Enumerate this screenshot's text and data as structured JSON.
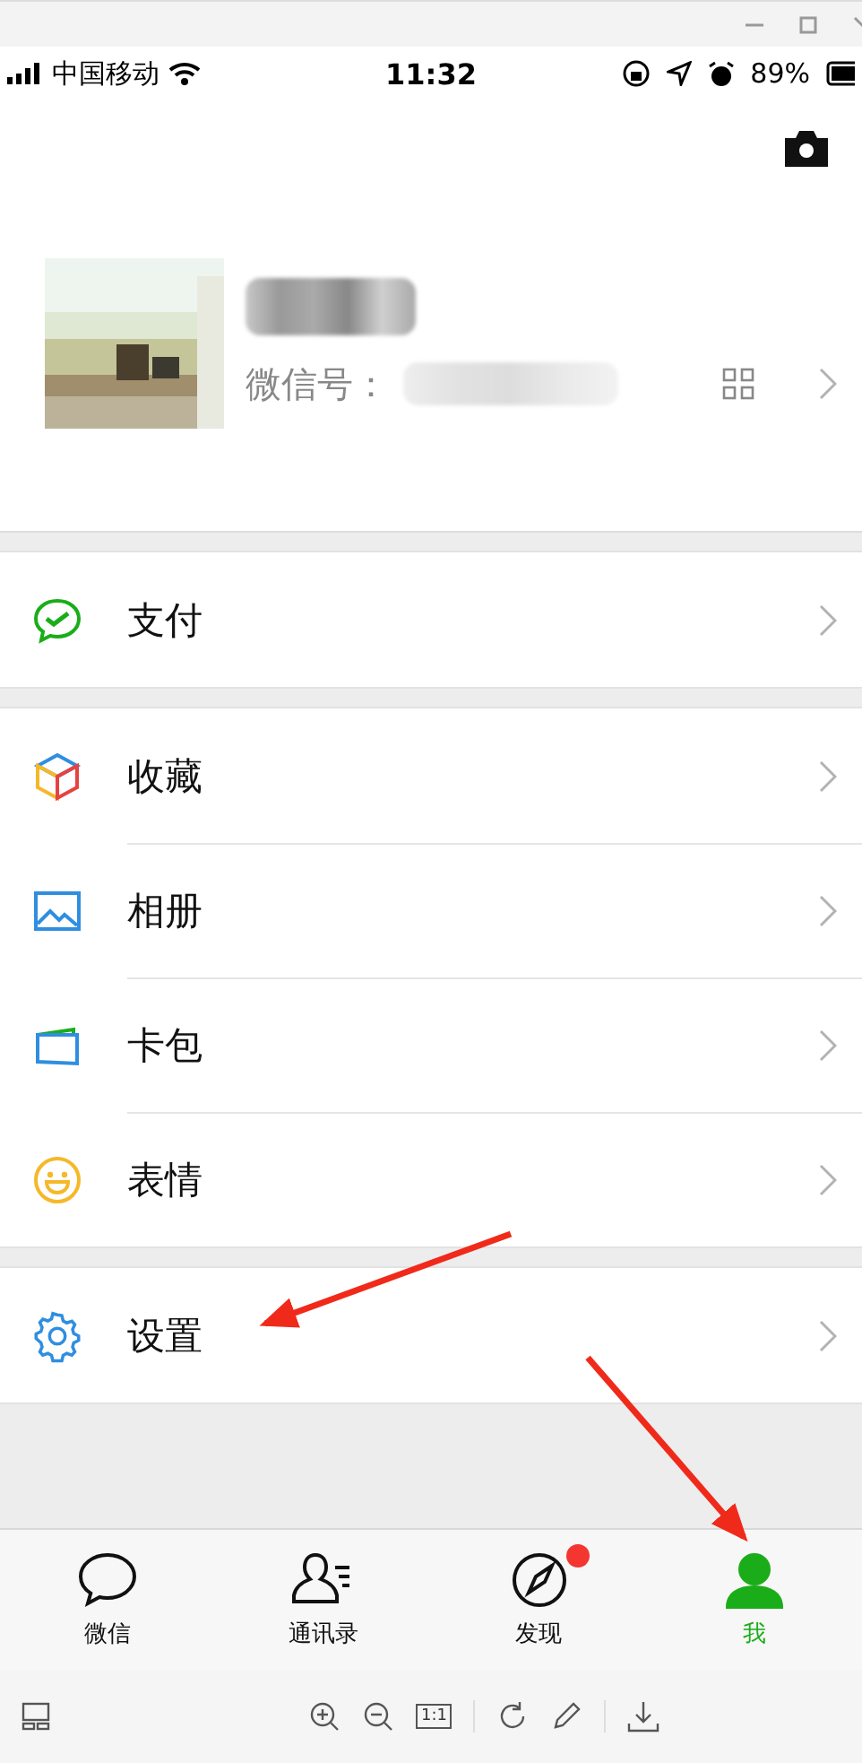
{
  "status_bar": {
    "carrier": "中国移动",
    "time": "11:32",
    "battery": "89%"
  },
  "profile": {
    "id_label": "微信号："
  },
  "menu_groups": [
    {
      "items": [
        {
          "kind": "pay",
          "label": "支付"
        }
      ]
    },
    {
      "items": [
        {
          "kind": "favorites",
          "label": "收藏"
        },
        {
          "kind": "album",
          "label": "相册"
        },
        {
          "kind": "cards",
          "label": "卡包"
        },
        {
          "kind": "stickers",
          "label": "表情"
        }
      ]
    },
    {
      "items": [
        {
          "kind": "settings",
          "label": "设置"
        }
      ]
    }
  ],
  "tab_bar": [
    {
      "kind": "chats",
      "label": "微信",
      "selected": false,
      "badge": false
    },
    {
      "kind": "contacts",
      "label": "通讯录",
      "selected": false,
      "badge": false
    },
    {
      "kind": "discover",
      "label": "发现",
      "selected": false,
      "badge": true
    },
    {
      "kind": "me",
      "label": "我",
      "selected": true,
      "badge": false
    }
  ],
  "viewer_toolbar": {
    "actual_size": "1:1"
  }
}
